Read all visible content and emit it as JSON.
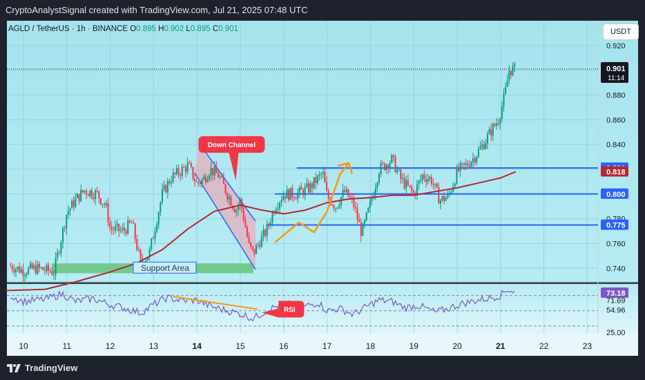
{
  "header": {
    "title": "CryptoAnalystSignal created with TradingView.com, Jul 21, 2025 07:48 UTC"
  },
  "legend": {
    "symbol": "AGLD / TetherUS · 1h · BINANCE",
    "o_label": "O",
    "o_value": "0.895",
    "h_label": "H",
    "h_value": "0.902",
    "l_label": "L",
    "l_value": "0.895",
    "c_label": "C",
    "c_value": "0.901"
  },
  "currency_button": "USDT",
  "footer": {
    "brand": "TradingView"
  },
  "colors": {
    "panel_bg": "#a8e4ef",
    "candle_up": "#089981",
    "candle_down": "#f23645",
    "ma": "#b22833",
    "level": "#2962ff",
    "rsi": "#7e57c2"
  },
  "chart_data": {
    "type": "candlestick",
    "x_ticks": [
      "10",
      "11",
      "12",
      "13",
      "14",
      "15",
      "16",
      "17",
      "18",
      "19",
      "20",
      "21",
      "22",
      "23"
    ],
    "bold_x_ticks": [
      "14",
      "21"
    ],
    "y_ticks": [
      "0.920",
      "0.880",
      "0.860",
      "0.840",
      "0.780",
      "0.760",
      "0.740"
    ],
    "ylim": [
      0.729,
      0.94
    ],
    "price_labels": [
      {
        "value": 0.901,
        "label": "0.901",
        "sub": "11:14",
        "kind": "current"
      },
      {
        "value": 0.821,
        "label": "0.821",
        "kind": "level"
      },
      {
        "value": 0.818,
        "label": "0.818",
        "kind": "ma"
      },
      {
        "value": 0.8,
        "label": "0.800",
        "kind": "level"
      },
      {
        "value": 0.775,
        "label": "0.775",
        "kind": "level"
      }
    ],
    "horizontal_levels": [
      {
        "value": 0.821,
        "from": 16.3,
        "to": 23.2
      },
      {
        "value": 0.8,
        "from": 15.8,
        "to": 23.2
      },
      {
        "value": 0.775,
        "from": 15.6,
        "to": 23.2
      }
    ],
    "price_anchors": [
      [
        9.7,
        0.742
      ],
      [
        10.0,
        0.738
      ],
      [
        10.3,
        0.74
      ],
      [
        10.7,
        0.737
      ],
      [
        11.0,
        0.785
      ],
      [
        11.2,
        0.795
      ],
      [
        11.4,
        0.803
      ],
      [
        11.7,
        0.8
      ],
      [
        11.9,
        0.79
      ],
      [
        12.0,
        0.772
      ],
      [
        12.3,
        0.77
      ],
      [
        12.5,
        0.777
      ],
      [
        12.7,
        0.744
      ],
      [
        12.9,
        0.752
      ],
      [
        13.0,
        0.768
      ],
      [
        13.2,
        0.8
      ],
      [
        13.4,
        0.813
      ],
      [
        13.6,
        0.818
      ],
      [
        13.8,
        0.823
      ],
      [
        14.0,
        0.808
      ],
      [
        14.15,
        0.812
      ],
      [
        14.3,
        0.82
      ],
      [
        14.5,
        0.815
      ],
      [
        14.7,
        0.8
      ],
      [
        14.9,
        0.787
      ],
      [
        15.0,
        0.795
      ],
      [
        15.2,
        0.758
      ],
      [
        15.3,
        0.752
      ],
      [
        15.45,
        0.762
      ],
      [
        15.6,
        0.77
      ],
      [
        15.8,
        0.79
      ],
      [
        16.0,
        0.8
      ],
      [
        16.3,
        0.8
      ],
      [
        16.6,
        0.805
      ],
      [
        16.9,
        0.817
      ],
      [
        17.0,
        0.798
      ],
      [
        17.2,
        0.79
      ],
      [
        17.4,
        0.802
      ],
      [
        17.6,
        0.793
      ],
      [
        17.8,
        0.768
      ],
      [
        18.0,
        0.792
      ],
      [
        18.2,
        0.82
      ],
      [
        18.5,
        0.828
      ],
      [
        18.7,
        0.812
      ],
      [
        19.0,
        0.8
      ],
      [
        19.2,
        0.815
      ],
      [
        19.4,
        0.812
      ],
      [
        19.6,
        0.795
      ],
      [
        19.8,
        0.798
      ],
      [
        20.0,
        0.818
      ],
      [
        20.2,
        0.823
      ],
      [
        20.4,
        0.83
      ],
      [
        20.6,
        0.84
      ],
      [
        20.8,
        0.852
      ],
      [
        20.95,
        0.86
      ],
      [
        21.1,
        0.88
      ],
      [
        21.2,
        0.9
      ],
      [
        21.35,
        0.901
      ]
    ],
    "moving_average": [
      [
        9.6,
        0.722
      ],
      [
        10.5,
        0.723
      ],
      [
        11.2,
        0.729
      ],
      [
        12.0,
        0.737
      ],
      [
        12.6,
        0.744
      ],
      [
        13.2,
        0.755
      ],
      [
        13.8,
        0.772
      ],
      [
        14.4,
        0.786
      ],
      [
        15.0,
        0.791
      ],
      [
        15.5,
        0.787
      ],
      [
        16.0,
        0.784
      ],
      [
        16.5,
        0.787
      ],
      [
        17.0,
        0.793
      ],
      [
        17.5,
        0.796
      ],
      [
        18.0,
        0.797
      ],
      [
        18.5,
        0.799
      ],
      [
        19.0,
        0.799
      ],
      [
        19.5,
        0.802
      ],
      [
        20.0,
        0.805
      ],
      [
        20.5,
        0.809
      ],
      [
        21.0,
        0.813
      ],
      [
        21.35,
        0.818
      ]
    ],
    "down_channel": {
      "label": "Down Channel",
      "upper": [
        [
          14.05,
          0.841
        ],
        [
          15.35,
          0.778
        ]
      ],
      "lower": [
        [
          13.95,
          0.817
        ],
        [
          15.35,
          0.739
        ]
      ]
    },
    "support_area": {
      "label": "Support Area",
      "from": 10.65,
      "to": 15.3,
      "low": 0.736,
      "high": 0.744
    },
    "arrow_path": [
      [
        15.8,
        0.761
      ],
      [
        16.35,
        0.777
      ],
      [
        16.7,
        0.769
      ],
      [
        17.0,
        0.786
      ],
      [
        17.3,
        0.816
      ],
      [
        17.5,
        0.825
      ]
    ],
    "rsi": {
      "y_ticks": [
        "71.69",
        "54.96",
        "25.00"
      ],
      "current": "73.18",
      "ylim": [
        20,
        85
      ],
      "dashed_levels": [
        70,
        50,
        30
      ],
      "label": "RSI",
      "divergence_line": [
        [
          13.45,
          68.5
        ],
        [
          15.4,
          52
        ]
      ],
      "anchors": [
        [
          9.7,
          70
        ],
        [
          10.0,
          62
        ],
        [
          10.5,
          65
        ],
        [
          10.9,
          72
        ],
        [
          11.2,
          62
        ],
        [
          11.6,
          66
        ],
        [
          12.0,
          58
        ],
        [
          12.3,
          54
        ],
        [
          12.7,
          47
        ],
        [
          13.0,
          58
        ],
        [
          13.3,
          67
        ],
        [
          13.7,
          63
        ],
        [
          14.0,
          64
        ],
        [
          14.3,
          56
        ],
        [
          14.7,
          50
        ],
        [
          15.0,
          46
        ],
        [
          15.3,
          40
        ],
        [
          15.6,
          50
        ],
        [
          16.0,
          60
        ],
        [
          16.4,
          54
        ],
        [
          16.8,
          61
        ],
        [
          17.0,
          50
        ],
        [
          17.3,
          53
        ],
        [
          17.6,
          45
        ],
        [
          17.9,
          55
        ],
        [
          18.2,
          64
        ],
        [
          18.5,
          62
        ],
        [
          18.8,
          54
        ],
        [
          19.1,
          57
        ],
        [
          19.5,
          48
        ],
        [
          19.8,
          53
        ],
        [
          20.1,
          59
        ],
        [
          20.4,
          63
        ],
        [
          20.7,
          66
        ],
        [
          21.0,
          70
        ],
        [
          21.15,
          78
        ],
        [
          21.35,
          74
        ]
      ]
    }
  }
}
